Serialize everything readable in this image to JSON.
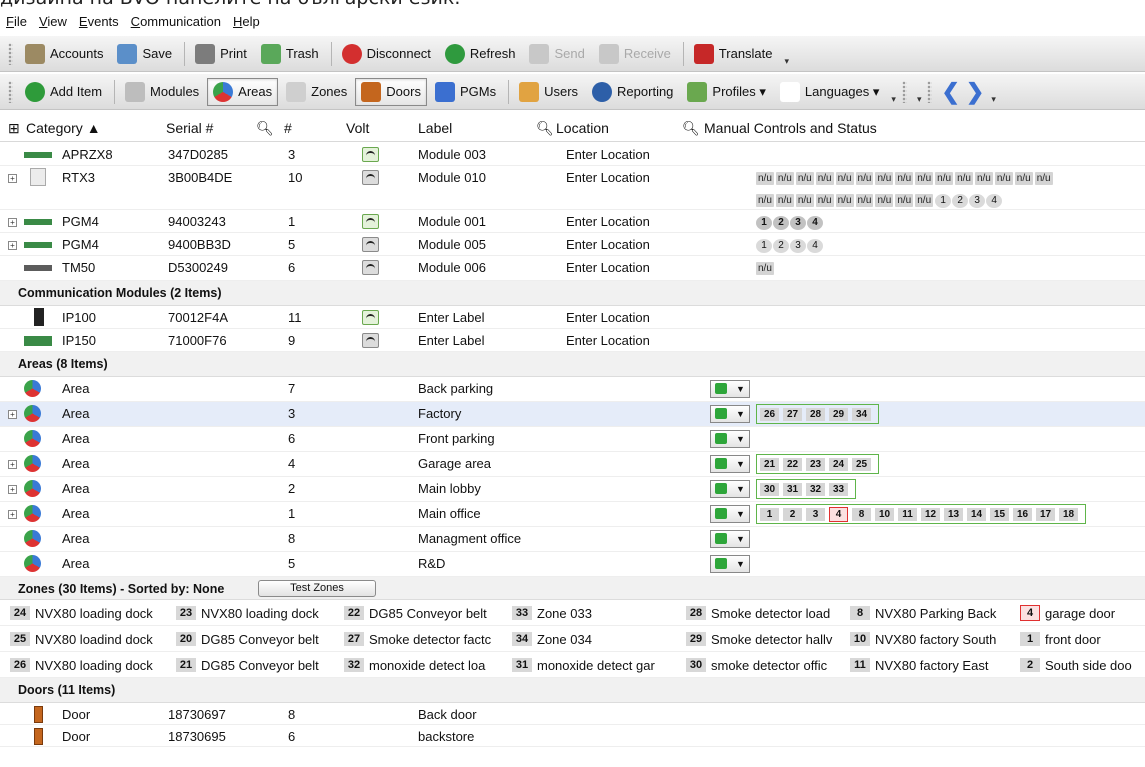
{
  "banner_text": "дизайна на BVO панелите на български език.",
  "menu": [
    "File",
    "View",
    "Events",
    "Communication",
    "Help"
  ],
  "toolbar1": [
    {
      "label": "Accounts",
      "icon": "folder-icon",
      "color": "#9c8a63"
    },
    {
      "label": "Save",
      "icon": "save-icon",
      "color": "#5b8fc9"
    },
    {
      "label": "Print",
      "icon": "printer-icon",
      "color": "#7c7c7c"
    },
    {
      "label": "Trash",
      "icon": "trash-icon",
      "color": "#5aa85a"
    },
    {
      "label": "Disconnect",
      "icon": "disconnect-icon",
      "color": "#d32f2f"
    },
    {
      "label": "Refresh",
      "icon": "refresh-icon",
      "color": "#2f9a3e"
    },
    {
      "label": "Send",
      "icon": "send-icon",
      "color": "#c8c8c8"
    },
    {
      "label": "Receive",
      "icon": "receive-icon",
      "color": "#c8c8c8"
    },
    {
      "label": "Translate",
      "icon": "translate-icon",
      "color": "#c62828"
    }
  ],
  "toolbar2": [
    {
      "label": "Add Item",
      "icon": "add-icon",
      "color": "#2e9b3a"
    },
    {
      "label": "Modules",
      "icon": "modules-icon",
      "color": "#bdbdbd"
    },
    {
      "label": "Areas",
      "icon": "areas-icon",
      "color": "#3a7ad6"
    },
    {
      "label": "Zones",
      "icon": "zones-icon",
      "color": "#cfcfcf"
    },
    {
      "label": "Doors",
      "icon": "door-icon",
      "color": "#c4661e"
    },
    {
      "label": "PGMs",
      "icon": "pgm-icon",
      "color": "#3b6fd0"
    },
    {
      "label": "Users",
      "icon": "users-icon",
      "color": "#e1a341"
    },
    {
      "label": "Reporting",
      "icon": "reporting-icon",
      "color": "#2d5fa8"
    },
    {
      "label": "Profiles ▾",
      "icon": "profiles-icon",
      "color": "#6aa84f"
    },
    {
      "label": "Languages ▾",
      "icon": "languages-icon",
      "color": "#ffffff"
    }
  ],
  "columns": {
    "category": "Category ▲",
    "serial": "Serial #",
    "number": "#",
    "volt": "Volt",
    "label": "Label",
    "location": "Location",
    "manual": "Manual Controls and Status"
  },
  "modules": [
    {
      "category": "APRZX8",
      "serial": "347D0285",
      "num": "3",
      "volt": "ok",
      "label": "Module 003",
      "location": "Enter Location"
    },
    {
      "category": "RTX3",
      "serial": "3B00B4DE",
      "num": "10",
      "volt": "bad",
      "label": "Module 010",
      "location": "Enter Location"
    },
    {
      "category": "PGM4",
      "serial": "94003243",
      "num": "1",
      "volt": "ok",
      "label": "Module 001",
      "location": "Enter Location"
    },
    {
      "category": "PGM4",
      "serial": "9400BB3D",
      "num": "5",
      "volt": "bad",
      "label": "Module 005",
      "location": "Enter Location"
    },
    {
      "category": "TM50",
      "serial": "D5300249",
      "num": "6",
      "volt": "bad",
      "label": "Module 006",
      "location": "Enter Location"
    }
  ],
  "comm_group": "Communication Modules (2 Items)",
  "comm": [
    {
      "category": "IP100",
      "serial": "70012F4A",
      "num": "11",
      "volt": "ok",
      "label": "Enter Label",
      "location": "Enter Location"
    },
    {
      "category": "IP150",
      "serial": "71000F76",
      "num": "9",
      "volt": "bad",
      "label": "Enter Label",
      "location": "Enter Location"
    }
  ],
  "nu_text": "n/u",
  "pgm_circles": [
    "1",
    "2",
    "3",
    "4"
  ],
  "areas_group": "Areas (8 Items)",
  "area_category": "Area",
  "areas": [
    {
      "num": "7",
      "label": "Back parking",
      "zones": []
    },
    {
      "num": "3",
      "label": "Factory",
      "zones": [
        "26",
        "27",
        "28",
        "29",
        "34"
      ]
    },
    {
      "num": "6",
      "label": "Front parking",
      "zones": []
    },
    {
      "num": "4",
      "label": "Garage area",
      "zones": [
        "21",
        "22",
        "23",
        "24",
        "25"
      ]
    },
    {
      "num": "2",
      "label": "Main lobby",
      "zones": [
        "30",
        "31",
        "32",
        "33"
      ]
    },
    {
      "num": "1",
      "label": "Main office",
      "zones": [
        "1",
        "2",
        "3",
        "4",
        "8",
        "10",
        "11",
        "12",
        "13",
        "14",
        "15",
        "16",
        "17",
        "18"
      ]
    },
    {
      "num": "8",
      "label": "Managment office",
      "zones": []
    },
    {
      "num": "5",
      "label": "R&D",
      "zones": []
    }
  ],
  "zones_group": "Zones (30 Items) - Sorted by: None",
  "test_zones": "Test Zones",
  "zone_tiles": [
    [
      {
        "n": "24",
        "t": "NVX80 loading dock"
      },
      {
        "n": "23",
        "t": "NVX80 loading dock"
      },
      {
        "n": "22",
        "t": "DG85 Conveyor belt"
      },
      {
        "n": "33",
        "t": "Zone 033"
      },
      {
        "n": "28",
        "t": "Smoke detector load"
      },
      {
        "n": "8",
        "t": "NVX80 Parking Back"
      },
      {
        "n": "4",
        "t": "garage door",
        "alarm": true
      }
    ],
    [
      {
        "n": "25",
        "t": "NVX80 loadind dock"
      },
      {
        "n": "20",
        "t": "DG85 Conveyor belt"
      },
      {
        "n": "27",
        "t": "Smoke detector factc"
      },
      {
        "n": "34",
        "t": "Zone 034"
      },
      {
        "n": "29",
        "t": "Smoke detector hallv"
      },
      {
        "n": "10",
        "t": "NVX80 factory South"
      },
      {
        "n": "1",
        "t": "front door"
      }
    ],
    [
      {
        "n": "26",
        "t": "NVX80 loading dock"
      },
      {
        "n": "21",
        "t": "DG85 Conveyor belt"
      },
      {
        "n": "32",
        "t": "monoxide detect loa"
      },
      {
        "n": "31",
        "t": "monoxide detect gar"
      },
      {
        "n": "30",
        "t": "smoke detector offic"
      },
      {
        "n": "11",
        "t": "NVX80 factory East"
      },
      {
        "n": "2",
        "t": "South side doo"
      }
    ]
  ],
  "doors_group": "Doors (11 Items)",
  "door_category": "Door",
  "doors": [
    {
      "serial": "18730697",
      "num": "8",
      "label": "Back door"
    },
    {
      "serial": "18730695",
      "num": "6",
      "label": "backstore"
    }
  ]
}
